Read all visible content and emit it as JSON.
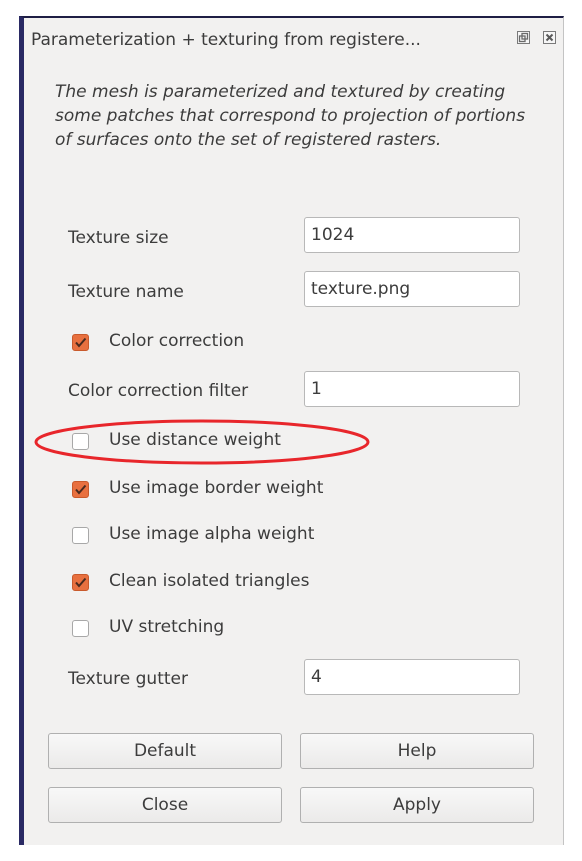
{
  "window": {
    "title": "Parameterization + texturing from registere...",
    "float_icon": "float-window-icon",
    "close_icon": "close-icon"
  },
  "description": "The mesh is parameterized and textured by creating some patches that correspond to projection of portions of surfaces onto the set of registered rasters.",
  "fields": {
    "texture_size": {
      "label": "Texture size",
      "value": "1024"
    },
    "texture_name": {
      "label": "Texture name",
      "value": "texture.png"
    },
    "color_correction_filter": {
      "label": "Color correction filter",
      "value": "1"
    },
    "texture_gutter": {
      "label": "Texture gutter",
      "value": "4"
    }
  },
  "checkboxes": {
    "color_correction": {
      "label": "Color correction",
      "checked": true
    },
    "use_distance_weight": {
      "label": "Use distance weight",
      "checked": false
    },
    "use_image_border_weight": {
      "label": "Use image border weight",
      "checked": true
    },
    "use_image_alpha_weight": {
      "label": "Use image alpha weight",
      "checked": false
    },
    "clean_isolated_triangles": {
      "label": "Clean isolated triangles",
      "checked": true
    },
    "uv_stretching": {
      "label": "UV stretching",
      "checked": false
    }
  },
  "buttons": {
    "default": "Default",
    "help": "Help",
    "close": "Close",
    "apply": "Apply"
  },
  "annotation": {
    "highlight_target": "Use distance weight",
    "color": "#e8262b"
  },
  "colors": {
    "checkbox_on": "#e8703f",
    "panel_bg": "#f2f1f0",
    "border_accent": "#2a2a64"
  }
}
